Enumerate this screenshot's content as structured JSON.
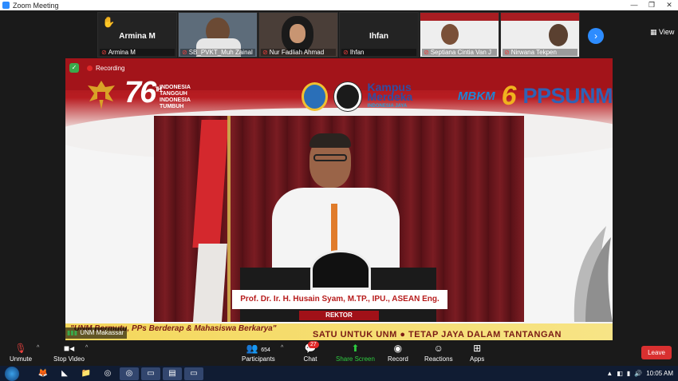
{
  "window": {
    "title": "Zoom Meeting",
    "minimize": "—",
    "maximize": "❐",
    "close": "✕"
  },
  "gallery": {
    "tiles": [
      {
        "display_name": "Armina M",
        "label": "Armina M",
        "raised_hand": true
      },
      {
        "label": "SB_PVKT_Muh Zainal"
      },
      {
        "label": "Nur Fadliah Ahmad"
      },
      {
        "display_name": "Ihfan",
        "label": "Ihfan"
      },
      {
        "label": "Septiana Cintia Van J"
      },
      {
        "label": "Nirwana Tekpen"
      }
    ],
    "next_icon": "›",
    "view_label": "View"
  },
  "stage": {
    "recording_label": "Recording",
    "anniversary_number": "76",
    "anniversary_sup": "TH",
    "anniversary_tagline": [
      "INDONESIA",
      "TANGGUH",
      "INDONESIA",
      "TUMBUH"
    ],
    "logos": {
      "kampus_merdeka": "Kampus Merdeka",
      "kampus_merdeka_sub": "INDONESIA JAYA",
      "mbkm": "MBKM",
      "six": "6",
      "pps": "PPSUNM"
    },
    "speaker_name": "Prof. Dr. Ir. H. Husain Syam, M.TP., IPU., ASEAN Eng.",
    "speaker_role": "REKTOR",
    "motto": "\"UNM Bermutu, PPs Berderap & Mahasiswa Berkarya\"",
    "slogan": "SATU UNTUK UNM ● TETAP JAYA DALAM TANTANGAN",
    "source_label": "UNM Makassar"
  },
  "toolbar": {
    "unmute": "Unmute",
    "stop_video": "Stop Video",
    "participants_count": "654",
    "participants": "Participants",
    "chat_badge": "27",
    "chat": "Chat",
    "share_screen": "Share Screen",
    "record": "Record",
    "reactions": "Reactions",
    "apps": "Apps",
    "leave": "Leave"
  },
  "taskbar": {
    "time": "10:05 AM"
  }
}
